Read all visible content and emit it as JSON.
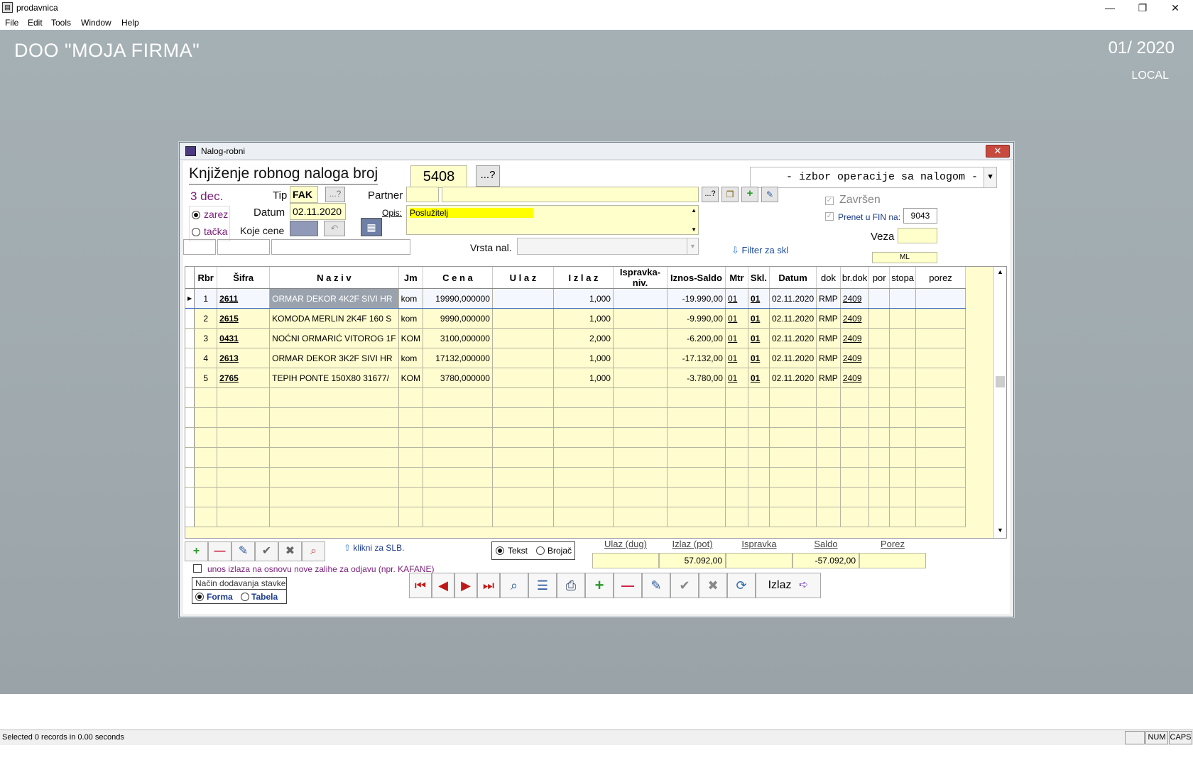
{
  "window": {
    "title": "prodavnica"
  },
  "menu": {
    "items": [
      "File",
      "Edit",
      "Tools",
      "Window",
      "Help"
    ]
  },
  "desktop": {
    "company": "DOO  \"MOJA FIRMA\"",
    "period": "01/ 2020",
    "location": "LOCAL"
  },
  "dialog": {
    "title": "Nalog-robni",
    "heading": "Knjiženje robnog naloga broj",
    "number": "5408",
    "lookup_label": "...?",
    "operation_placeholder": "- izbor operacije sa nalogom -",
    "date_label": "3 dec.",
    "decimal": {
      "zarez": "zarez",
      "tacka": "tačka",
      "selected": "zarez"
    },
    "tip_label": "Tip",
    "tip_value": "FAK",
    "datum_label": "Datum",
    "datum_value": "02.11.2020",
    "koje_cene_label": "Koje cene",
    "partner_label": "Partner",
    "opis_label": "Opis:",
    "opis_value": "Poslužitelj",
    "zavrsen_label": "Završen",
    "prenet_label": "Prenet u FIN na:",
    "prenet_value": "9043",
    "veza_label": "Veza",
    "vrsta_label": "Vrsta nal.",
    "filter_label": "Filter za skl",
    "ml_value": "ML"
  },
  "grid": {
    "columns": [
      "Rbr",
      "Šifra",
      "N a z i v",
      "Jm",
      "C e n a",
      "U l a z",
      "I z l a z",
      "Ispravka-niv.",
      "Iznos-Saldo",
      "Mtr",
      "Skl.",
      "Datum",
      "dok",
      "br.dok",
      "por",
      "stopa",
      "porez"
    ],
    "rows": [
      {
        "rbr": "1",
        "sifra": "2611",
        "naziv": "ORMAR DEKOR 4K2F SIVI HR",
        "jm": "kom",
        "cena": "19990,000000",
        "ulaz": "",
        "izlaz": "1,000",
        "ispravka": "",
        "iznos": "-19.990,00",
        "mtr": "01",
        "skl": "01",
        "datum": "02.11.2020",
        "dok": "RMP",
        "brdok": "2409"
      },
      {
        "rbr": "2",
        "sifra": "2615",
        "naziv": "KOMODA MERLIN 2K4F 160 S",
        "jm": "kom",
        "cena": "9990,000000",
        "ulaz": "",
        "izlaz": "1,000",
        "ispravka": "",
        "iznos": "-9.990,00",
        "mtr": "01",
        "skl": "01",
        "datum": "02.11.2020",
        "dok": "RMP",
        "brdok": "2409"
      },
      {
        "rbr": "3",
        "sifra": "0431",
        "naziv": "NOĆNI ORMARIĆ VITOROG 1F",
        "jm": "KOM",
        "cena": "3100,000000",
        "ulaz": "",
        "izlaz": "2,000",
        "ispravka": "",
        "iznos": "-6.200,00",
        "mtr": "01",
        "skl": "01",
        "datum": "02.11.2020",
        "dok": "RMP",
        "brdok": "2409"
      },
      {
        "rbr": "4",
        "sifra": "2613",
        "naziv": "ORMAR DEKOR 3K2F SIVI HR",
        "jm": "kom",
        "cena": "17132,000000",
        "ulaz": "",
        "izlaz": "1,000",
        "ispravka": "",
        "iznos": "-17.132,00",
        "mtr": "01",
        "skl": "01",
        "datum": "02.11.2020",
        "dok": "RMP",
        "brdok": "2409"
      },
      {
        "rbr": "5",
        "sifra": "2765",
        "naziv": "TEPIH PONTE 150X80 31677/",
        "jm": "KOM",
        "cena": "3780,000000",
        "ulaz": "",
        "izlaz": "1,000",
        "ispravka": "",
        "iznos": "-3.780,00",
        "mtr": "01",
        "skl": "01",
        "datum": "02.11.2020",
        "dok": "RMP",
        "brdok": "2409"
      }
    ]
  },
  "bottom": {
    "klikni_label": "klikni za SLB.",
    "tekst_label": "Tekst",
    "brojac_label": "Brojač",
    "unos_label": "unos izlaza na osnovu nove zalihe za odjavu (npr. KAFANE)",
    "nacin_label": "Način dodavanja stavke",
    "forma_label": "Forma",
    "tabela_label": "Tabela",
    "izlaz_button": "Izlaz"
  },
  "totals": {
    "headers": [
      "Ulaz (dug)",
      "Izlaz (pot)",
      "Ispravka",
      "Saldo",
      "Porez"
    ],
    "values": [
      "",
      "57.092,00",
      "",
      "-57.092,00",
      ""
    ]
  },
  "statusbar": {
    "message": "Selected 0 records in 0.00 seconds",
    "num": "NUM",
    "caps": "CAPS"
  },
  "colors": {
    "field": "#ffffcc",
    "desktop": "#a0aaae",
    "close": "#c84a3e",
    "purple": "#7a1f7a"
  }
}
